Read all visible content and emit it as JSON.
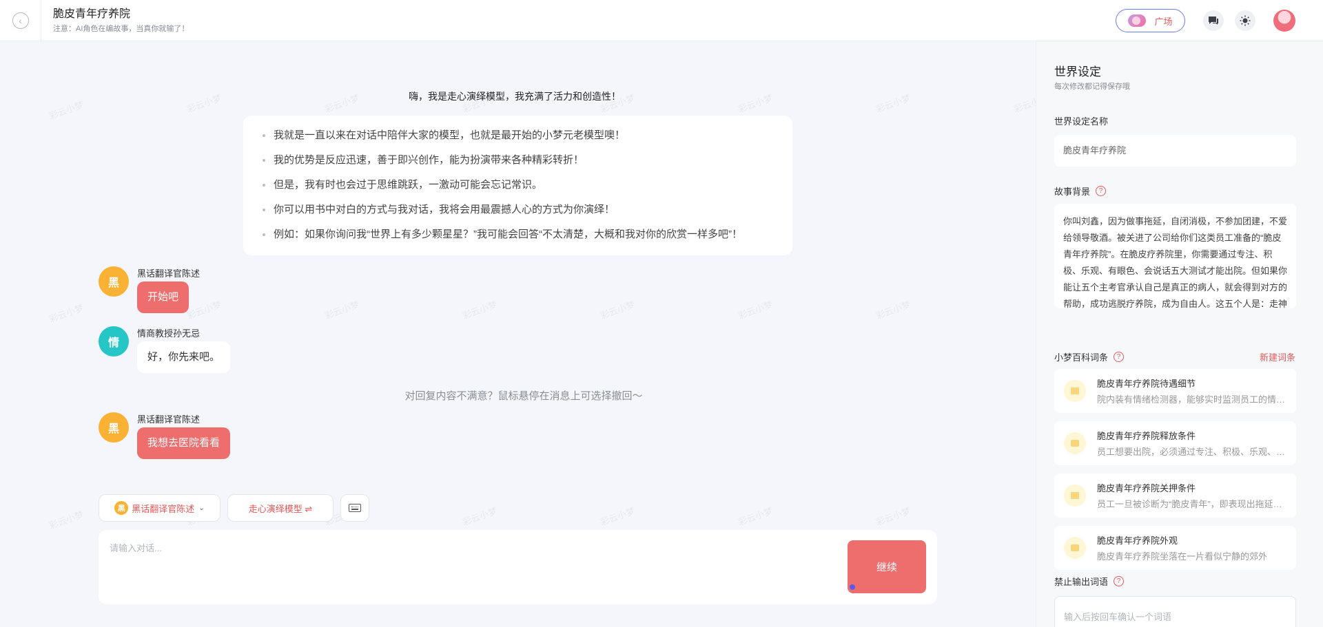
{
  "header": {
    "title": "脆皮青年疗养院",
    "subtitle": "注意：AI角色在编故事，当真你就输了！",
    "plaza_label": "广场"
  },
  "watermark": "彩云小梦",
  "intro": {
    "title": "嗨，我是走心演绎模型，我充满了活力和创造性！",
    "items": [
      "我就是一直以来在对话中陪伴大家的模型，也就是最开始的小梦元老模型噢！",
      "我的优势是反应迅速，善于即兴创作，能为扮演带来各种精彩转折！",
      "但是，我有时也会过于思维跳跃，一激动可能会忘记常识。",
      "你可以用书中对白的方式与我对话，我将会用最震撼人心的方式为你演绎！",
      "例如：如果你询问我“世界上有多少颗星星？”我可能会回答“不太清楚，大概和我对你的欣赏一样多吧”！"
    ]
  },
  "messages": [
    {
      "avatar": "黑",
      "name": "黑话翻译官陈述",
      "text": "开始吧",
      "color": "#f9b233"
    },
    {
      "avatar": "情",
      "name": "情商教授孙无忌",
      "text": "好，你先来吧。",
      "color": "#26c6c6"
    },
    {
      "avatar": "黑",
      "name": "黑话翻译官陈述",
      "text": "我想去医院看看",
      "color": "#f9b233"
    }
  ],
  "undo_tip": "对回复内容不满意？鼠标悬停在消息上可选择撤回～",
  "toolbar": {
    "role_avatar": "黑",
    "role_label": "黑话翻译官陈述",
    "model_label": "走心演绎模型 ⇌"
  },
  "input": {
    "placeholder": "请输入对话...",
    "send_label": "继续"
  },
  "panel": {
    "title": "世界设定",
    "subtitle": "每次修改都记得保存哦",
    "name_label": "世界设定名称",
    "name_value": "脆皮青年疗养院",
    "story_label": "故事背景",
    "story_value": "你叫刘鑫，因为做事拖延，自闭消极，不参加团建，不爱给领导敬酒。被关进了公司给你们这类员工准备的“脆皮青年疗养院”。在脆皮疗养院里，你需要通过专注、积极、乐观、有眼色、会说话五大测试才能出院。但如果你能让五个主考官承认自己是真正的病人，就会得到对方的帮助，成功逃脱疗养院，成为自由人。这五个人是：走神撞龟戒断师老李、鸡血注入",
    "wiki_label": "小梦百科词条",
    "new_entry_label": "新建词条",
    "entries": [
      {
        "title": "脆皮青年疗养院待遇细节",
        "desc": "院内装有情绪检测器，能够实时监测员工的情绪变化"
      },
      {
        "title": "脆皮青年疗养院释放条件",
        "desc": "员工想要出院，必须通过专注、积极、乐观、有眼色"
      },
      {
        "title": "脆皮青年疗养院关押条件",
        "desc": "员工一旦被诊断为“脆皮青年”，即表现出拖延、自闭"
      },
      {
        "title": "脆皮青年疗养院外观",
        "desc": "脆皮青年疗养院坐落在一片看似宁静的郊外"
      }
    ],
    "ban_label": "禁止输出词语",
    "ban_placeholder": "输入后按回车确认一个词语"
  }
}
